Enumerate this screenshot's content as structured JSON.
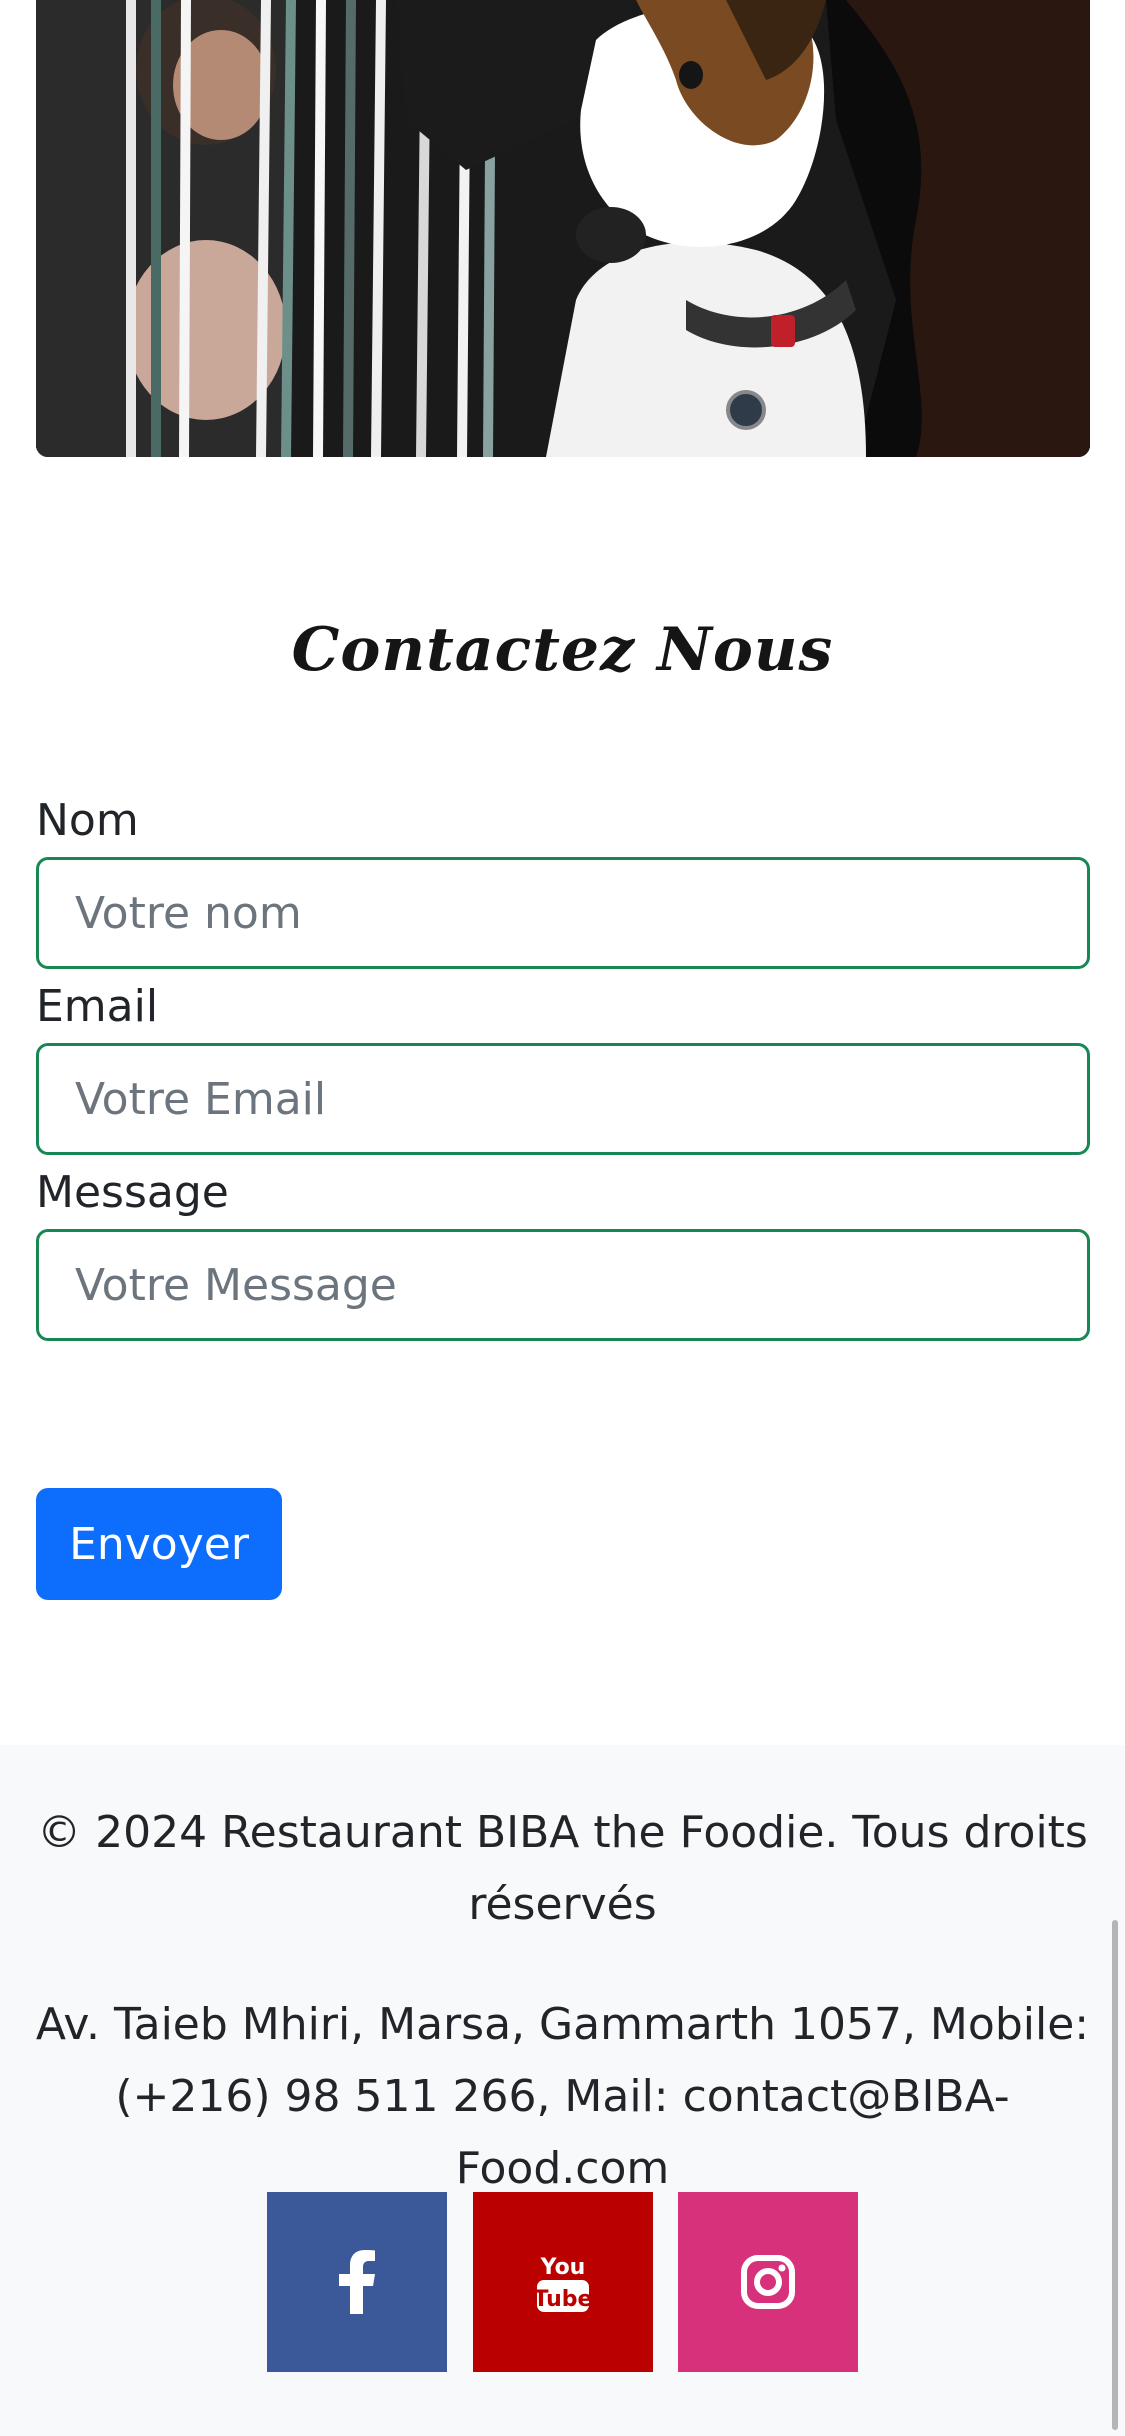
{
  "contact": {
    "title": "Contactez Nous",
    "name_label": "Nom",
    "name_placeholder": "Votre nom",
    "email_label": "Email",
    "email_placeholder": "Votre Email",
    "message_label": "Message",
    "message_placeholder": "Votre Message",
    "submit_label": "Envoyer"
  },
  "footer": {
    "copyright": "© 2024 Restaurant BIBA the Foodie. Tous droits réservés",
    "address": "Av. Taieb Mhiri, Marsa, Gammarth 1057, Mobile: (+216) 98 511 266, Mail: contact@BIBA-Food.com"
  },
  "social": [
    {
      "icon": "facebook-icon",
      "color": "#3b5998"
    },
    {
      "icon": "youtube-icon",
      "color": "#bb0000"
    },
    {
      "icon": "instagram-icon",
      "color": "#d6317a"
    }
  ]
}
